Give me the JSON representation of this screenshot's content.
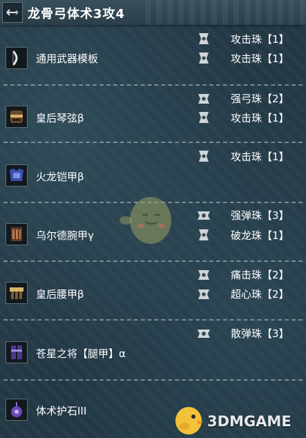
{
  "title": "龙骨弓体术3攻4",
  "equipment": [
    {
      "name": "通用武器模板",
      "icon": "bow-weapon-icon",
      "decorations": [
        {
          "label": "攻击珠【1】"
        },
        {
          "label": "攻击珠【1】"
        }
      ]
    },
    {
      "name": "皇后琴弦β",
      "icon": "helmet-icon",
      "decorations": [
        {
          "label": "强弓珠【2】"
        },
        {
          "label": "攻击珠【1】"
        }
      ]
    },
    {
      "name": "火龙铠甲β",
      "icon": "chest-armor-icon",
      "decorations": [
        {
          "label": "攻击珠【1】"
        }
      ]
    },
    {
      "name": "乌尔德腕甲γ",
      "icon": "arm-armor-icon",
      "decorations": [
        {
          "label": "强弹珠【3】"
        },
        {
          "label": "破龙珠【1】"
        }
      ]
    },
    {
      "name": "皇后腰甲β",
      "icon": "waist-armor-icon",
      "decorations": [
        {
          "label": "痛击珠【2】"
        },
        {
          "label": "超心珠【2】"
        }
      ]
    },
    {
      "name": "苍星之将【腿甲】α",
      "icon": "leg-armor-icon",
      "decorations": [
        {
          "label": "散弹珠【3】"
        }
      ]
    },
    {
      "name": "体术护石III",
      "icon": "charm-icon",
      "decorations": []
    }
  ],
  "watermark": "3DMGAME",
  "colors": {
    "background": "#233845",
    "title_bar": "#2f4653",
    "text": "#ffffff",
    "separator": "#b9c8d0"
  }
}
